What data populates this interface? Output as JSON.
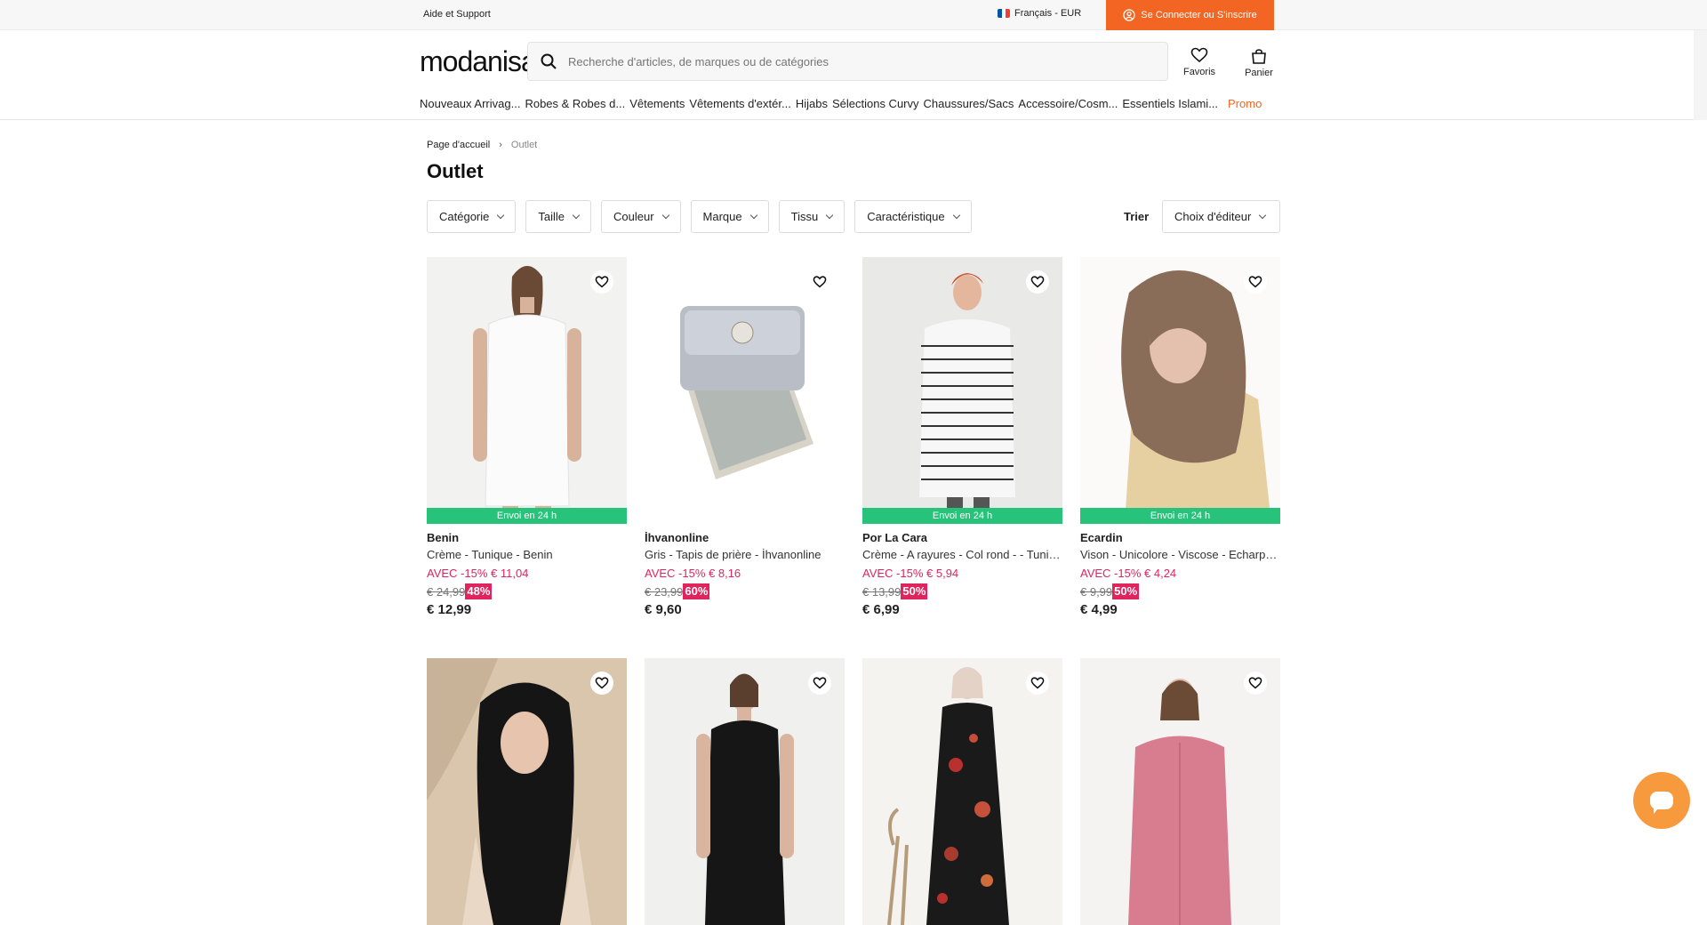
{
  "topbar": {
    "help": "Aide et Support",
    "language": "Français - EUR",
    "login": "Se Connecter ou S'inscrire"
  },
  "header": {
    "logo": "modanisa",
    "search_placeholder": "Recherche d'articles, de marques ou de catégories",
    "favorites": "Favoris",
    "cart": "Panier"
  },
  "nav": [
    "Nouveaux Arrivag...",
    "Robes & Robes d...",
    "Vêtements",
    "Vêtements d'extér...",
    "Hijabs",
    "Sélections Curvy",
    "Chaussures/Sacs",
    "Accessoire/Cosm...",
    "Essentiels Islami..."
  ],
  "nav_promo": "Promo",
  "breadcrumb": {
    "home": "Page d'accueil",
    "sep": "›",
    "current": "Outlet"
  },
  "page_title": "Outlet",
  "filters": [
    "Catégorie",
    "Taille",
    "Couleur",
    "Marque",
    "Tissu",
    "Caractéristique"
  ],
  "sort": {
    "label": "Trier",
    "value": "Choix d'éditeur"
  },
  "products": [
    {
      "brand": "Benin",
      "name": "Crème - Tunique - Benin",
      "promo": "AVEC -15% € 11,04",
      "old": "€ 24,99",
      "discount": "48%",
      "price": "€ 12,99",
      "shipping": "Envoi en 24 h"
    },
    {
      "brand": "İhvanonline",
      "name": "Gris - Tapis de prière - İhvanonline",
      "promo": "AVEC -15% € 8,16",
      "old": "€ 23,99",
      "discount": "60%",
      "price": "€ 9,60",
      "shipping": ""
    },
    {
      "brand": "Por La Cara",
      "name": "Crème - A rayures - Col rond - - Tunique - Por La Cara",
      "promo": "AVEC -15% € 5,94",
      "old": "€ 13,99",
      "discount": "50%",
      "price": "€ 6,99",
      "shipping": "Envoi en 24 h"
    },
    {
      "brand": "Ecardin",
      "name": "Vison - Unicolore - Viscose - Echarpe - Ecardin",
      "promo": "AVEC -15% € 4,24",
      "old": "€ 9,99",
      "discount": "50%",
      "price": "€ 4,99",
      "shipping": "Envoi en 24 h"
    },
    {
      "brand": "",
      "name": "",
      "promo": "",
      "old": "",
      "discount": "",
      "price": "",
      "shipping": ""
    },
    {
      "brand": "",
      "name": "",
      "promo": "",
      "old": "",
      "discount": "",
      "price": "",
      "shipping": ""
    },
    {
      "brand": "",
      "name": "",
      "promo": "",
      "old": "",
      "discount": "",
      "price": "",
      "shipping": ""
    },
    {
      "brand": "",
      "name": "",
      "promo": "",
      "old": "",
      "discount": "",
      "price": "",
      "shipping": ""
    }
  ],
  "colors": {
    "accent": "#f26522",
    "shipping": "#27c37a",
    "sale": "#e0245e",
    "chat": "#f79a3e"
  },
  "icons": {
    "search": "search-icon",
    "favorites": "heart-icon",
    "cart": "bag-icon",
    "user": "user-icon",
    "chat": "chat-icon"
  }
}
